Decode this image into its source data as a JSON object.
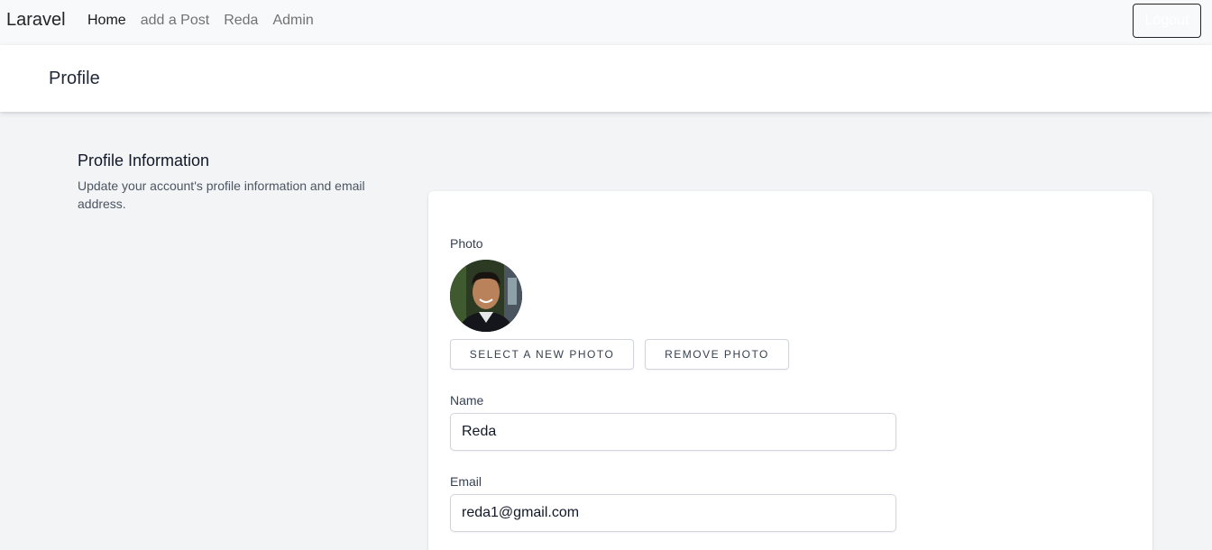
{
  "navbar": {
    "brand": "Laravel",
    "links": [
      {
        "label": "Home",
        "active": true
      },
      {
        "label": "add a Post",
        "active": false
      },
      {
        "label": "Reda",
        "active": false
      },
      {
        "label": "Admin",
        "active": false
      }
    ],
    "logout_label": "Logout"
  },
  "header": {
    "title": "Profile"
  },
  "section": {
    "title": "Profile Information",
    "description": "Update your account's profile information and email address."
  },
  "form": {
    "photo_label": "Photo",
    "select_photo_label": "Select A New Photo",
    "remove_photo_label": "Remove Photo",
    "name_label": "Name",
    "name_value": "Reda",
    "email_label": "Email",
    "email_value": "reda1@gmail.com"
  }
}
